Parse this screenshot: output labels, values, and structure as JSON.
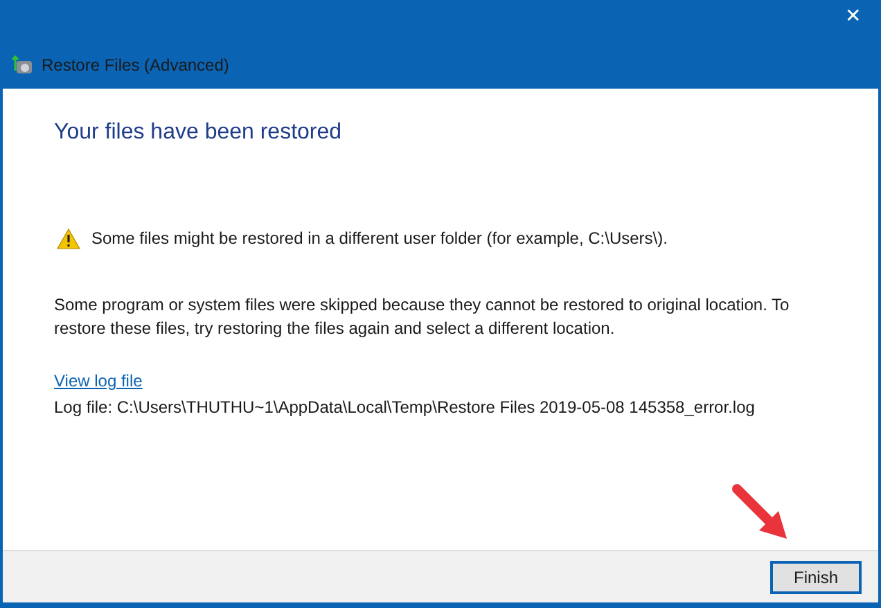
{
  "window": {
    "title": "Restore Files (Advanced)",
    "close": "✕"
  },
  "heading": "Your files have been restored",
  "warning": "Some files might be restored in a different user folder (for example, C:\\Users\\).",
  "message": "Some program or system files were skipped because they cannot be restored to original location. To restore these files, try restoring the files again and select a different location.",
  "log_link": "View log file",
  "log_path": "Log file: C:\\Users\\THUTHU~1\\AppData\\Local\\Temp\\Restore Files 2019-05-08 145358_error.log",
  "buttons": [
    {
      "label": "Finish",
      "selected": true
    }
  ]
}
